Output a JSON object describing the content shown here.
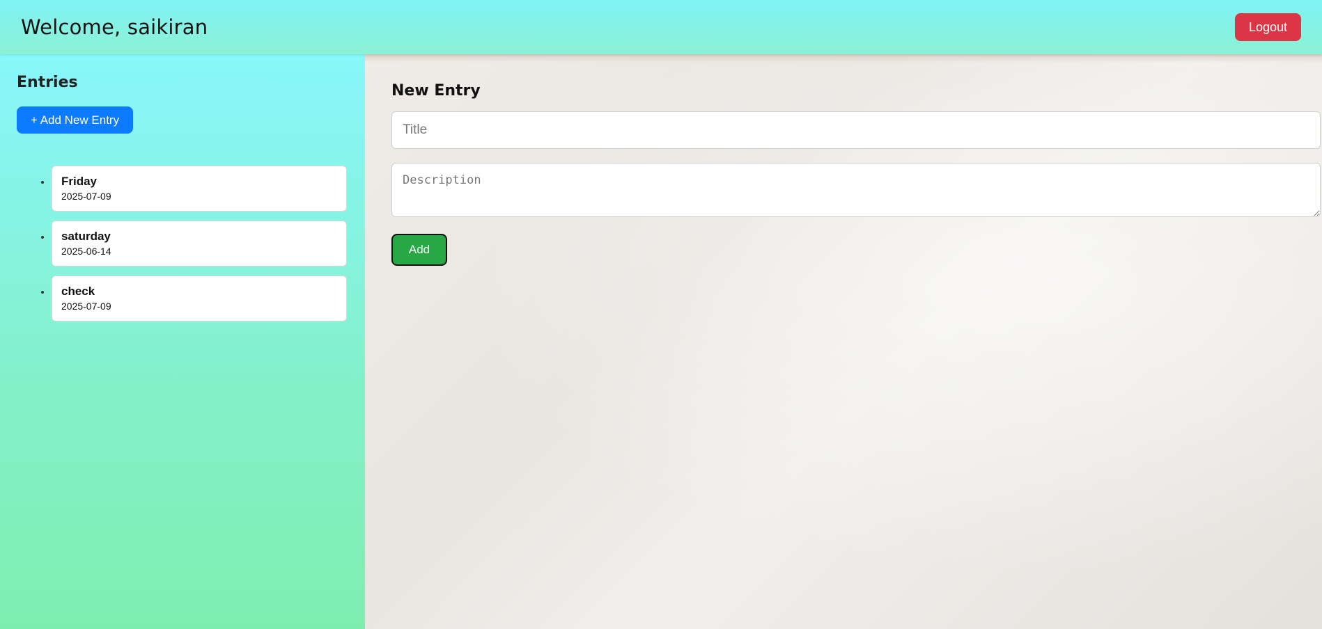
{
  "header": {
    "welcome": "Welcome, saikiran",
    "logout_label": "Logout"
  },
  "sidebar": {
    "title": "Entries",
    "add_new_label": "+ Add New Entry",
    "entries": [
      {
        "title": "Friday",
        "date": "2025-07-09"
      },
      {
        "title": "saturday",
        "date": "2025-06-14"
      },
      {
        "title": "check",
        "date": "2025-07-09"
      }
    ]
  },
  "main": {
    "title": "New Entry",
    "title_placeholder": "Title",
    "description_placeholder": "Description",
    "add_label": "Add"
  },
  "colors": {
    "logout": "#dc3545",
    "add_new": "#0d7bff",
    "add": "#28a745"
  }
}
